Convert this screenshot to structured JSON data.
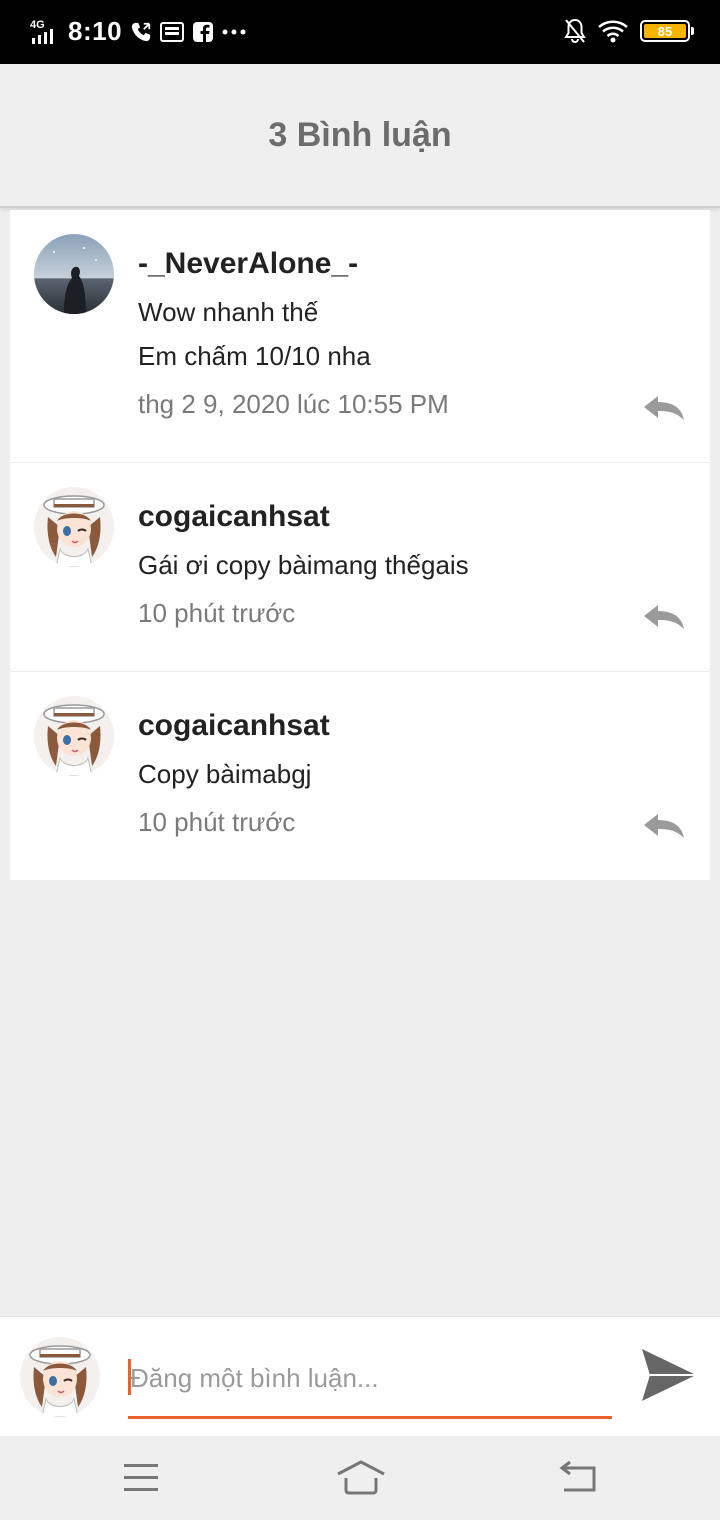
{
  "status_bar": {
    "network": "4G",
    "time": "8:10",
    "battery": "85",
    "icons": [
      "signal-icon",
      "call-icon",
      "message-icon",
      "facebook-icon",
      "more-icon",
      "mute-icon",
      "wifi-icon",
      "battery-icon"
    ]
  },
  "header": {
    "title": "3 Bình luận"
  },
  "comments": [
    {
      "author": "-_NeverAlone_-",
      "lines": [
        "Wow nhanh thế",
        "Em chấm 10/10 nha"
      ],
      "time": "thg 2 9, 2020 lúc 10:55 PM"
    },
    {
      "author": "cogaicanhsat",
      "lines": [
        "Gái ơi copy bàimang thếgais"
      ],
      "time": "10 phút trước"
    },
    {
      "author": "cogaicanhsat",
      "lines": [
        "Copy bàimabgj"
      ],
      "time": "10 phút trước"
    }
  ],
  "composer": {
    "placeholder": "Đăng một bình luận...",
    "value": ""
  },
  "colors": {
    "accent": "#e8622a",
    "header_bg": "#efefef",
    "page_bg": "#eeeeee",
    "battery": "#f4b400"
  }
}
